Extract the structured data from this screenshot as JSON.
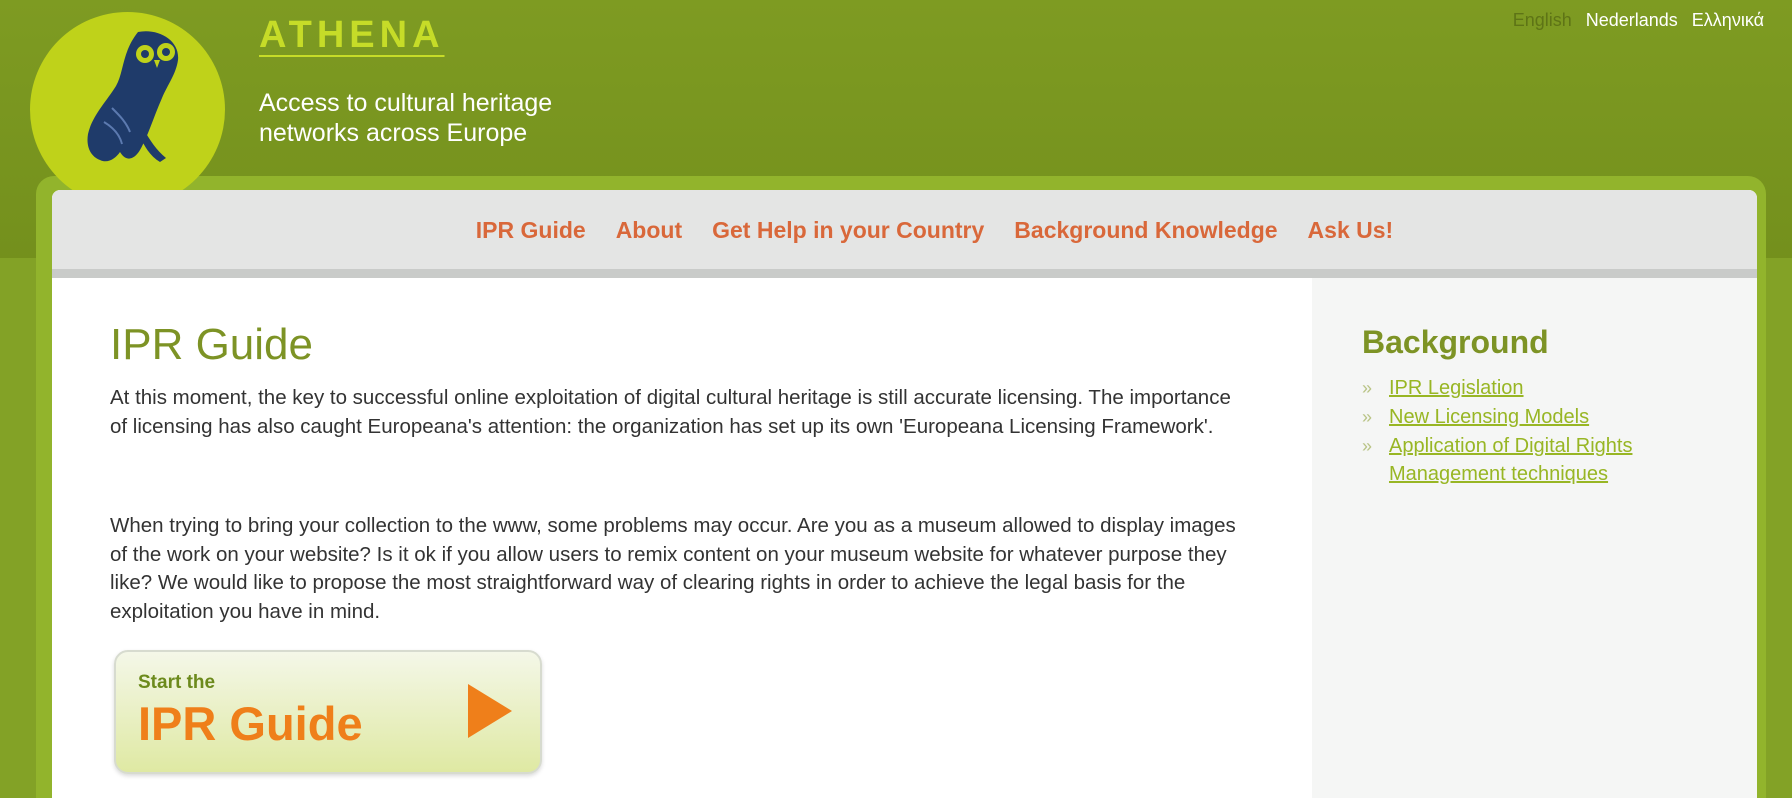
{
  "header": {
    "site_title": "ATHENA",
    "tagline_line1": "Access to cultural heritage",
    "tagline_line2": "networks across Europe",
    "logo_icon": "owl-logo-icon"
  },
  "languages": [
    {
      "label": "English",
      "active": true
    },
    {
      "label": "Nederlands",
      "active": false
    },
    {
      "label": "Ελληνικά",
      "active": false
    }
  ],
  "nav": [
    "IPR Guide",
    "About",
    "Get Help in your Country",
    "Background Knowledge",
    "Ask Us!"
  ],
  "main": {
    "title": "IPR Guide",
    "paragraph1": "At this moment, the key to successful online exploitation of digital cultural heritage is still accurate licensing. The importance of licensing has also caught Europeana's attention: the organization has set up its own 'Europeana Licensing Framework'.",
    "paragraph2": "When trying to bring your collection to the www, some problems may occur. Are you as a museum allowed to display images of the work on your website? Is it ok if you allow users to remix content on your museum website for whatever purpose they like? We would like to propose the most straightforward way of clearing rights in order to achieve the legal basis for the exploitation you have in mind.",
    "start_button": {
      "small_text": "Start the",
      "big_text": "IPR Guide",
      "icon": "play-arrow-icon"
    }
  },
  "sidebar": {
    "title": "Background",
    "bullet": "»",
    "links": [
      "IPR Legislation",
      "New Licensing Models",
      "Application of Digital Rights Management techniques"
    ]
  },
  "colors": {
    "header_green": "#7a9420",
    "logo_yellow_green": "#bfd21a",
    "nav_orange": "#d9683a",
    "title_green": "#7d9325",
    "link_green": "#98b624",
    "button_orange": "#ef7f1a"
  }
}
